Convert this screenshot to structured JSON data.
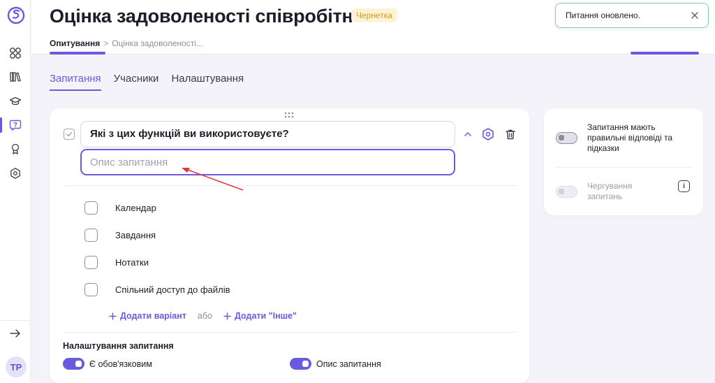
{
  "app": {
    "title": "Оцінка задоволеності співробітн...",
    "status": "Чернетка",
    "avatar_initials": "TP",
    "accent_color": "#6a5ae0"
  },
  "breadcrumb": {
    "root": "Опитування",
    "separator": ">",
    "current": "Оцінка задоволеності..."
  },
  "toast": {
    "message": "Питання оновлено.",
    "close_icon": "close-icon"
  },
  "sidebar": {
    "items": [
      {
        "icon": "grid-icon"
      },
      {
        "icon": "library-icon"
      },
      {
        "icon": "graduation-cap-icon"
      },
      {
        "icon": "chat-question-icon",
        "active": true
      },
      {
        "icon": "award-icon"
      },
      {
        "icon": "hexagon-icon"
      }
    ],
    "expand_icon": "arrow-right-icon"
  },
  "tabs": [
    {
      "label": "Запитання",
      "active": true
    },
    {
      "label": "Учасники",
      "active": false
    },
    {
      "label": "Налаштування",
      "active": false
    }
  ],
  "question": {
    "title": "Які з цих функцій ви використовуєте?",
    "description_placeholder": "Опис запитання",
    "options": [
      {
        "label": "Календар"
      },
      {
        "label": "Завдання"
      },
      {
        "label": "Нотатки"
      },
      {
        "label": "Спільний доступ до файлів"
      }
    ],
    "add_option": "Додати варіант",
    "or_text": "або",
    "add_other": "Додати \"Інше\"",
    "settings_title": "Налаштування запитання",
    "required_label": "Є обов'язковим",
    "description_toggle_label": "Опис запитання"
  },
  "side_panel": {
    "correct_answers_label": "Запитання мають правильні відповіді та підказки",
    "shuffle_label": "Чергування запитань"
  }
}
